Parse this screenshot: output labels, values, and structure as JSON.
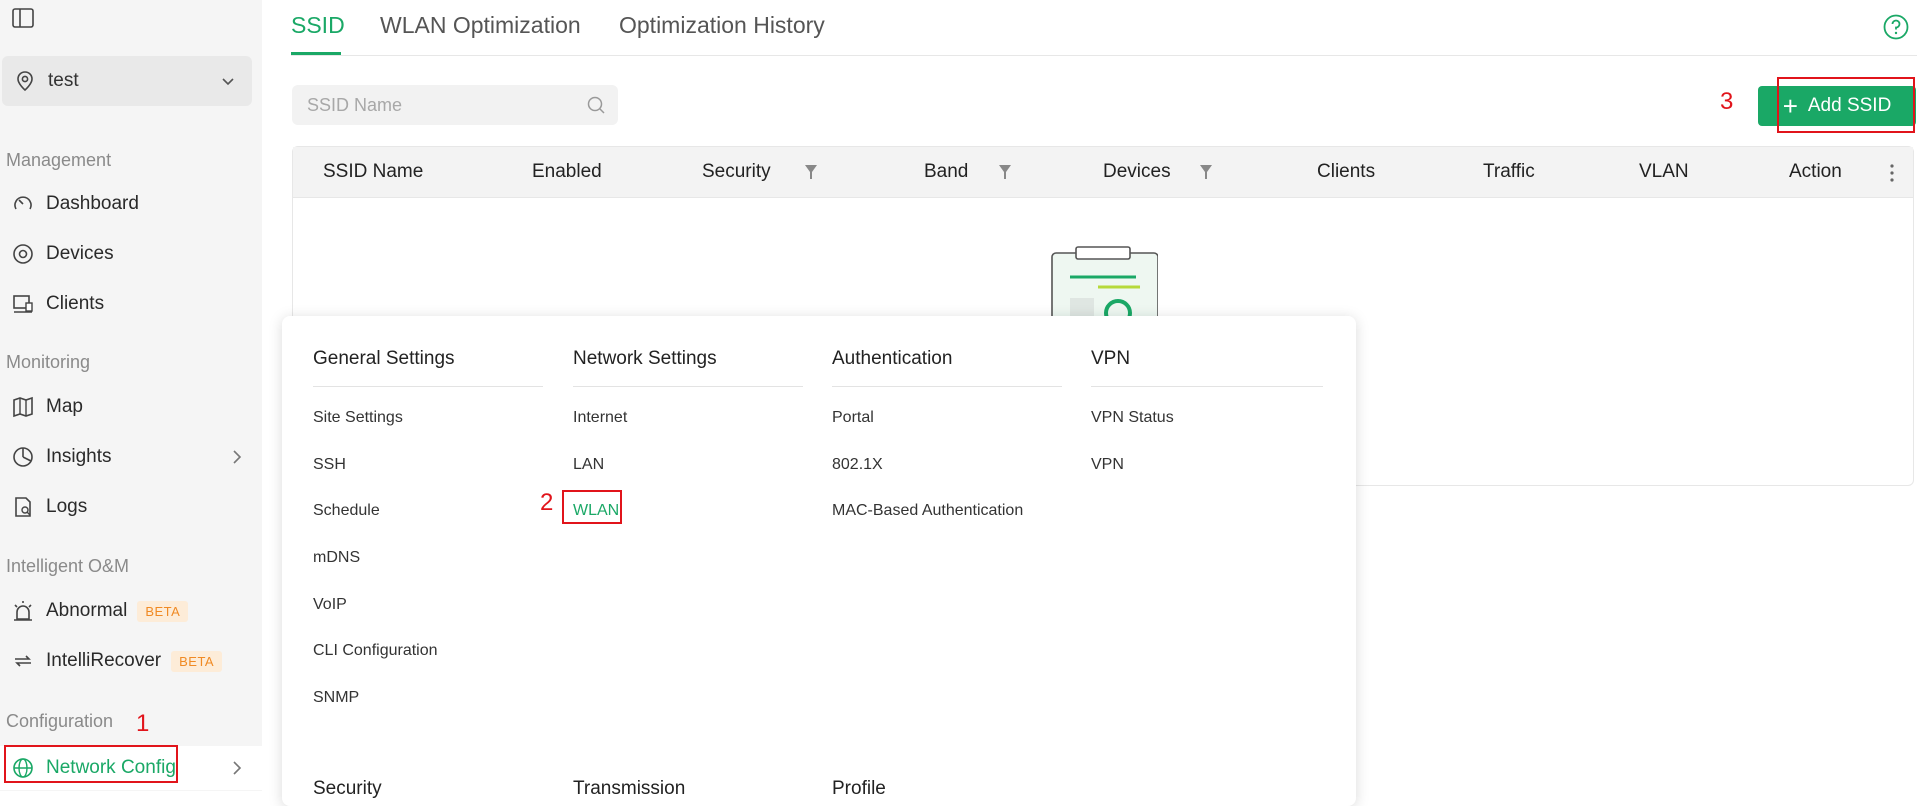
{
  "sidebar": {
    "site": "test",
    "sections": {
      "management": "Management",
      "monitoring": "Monitoring",
      "intelligent": "Intelligent O&M",
      "configuration": "Configuration"
    },
    "items": [
      {
        "label": "Dashboard"
      },
      {
        "label": "Devices"
      },
      {
        "label": "Clients"
      },
      {
        "label": "Map"
      },
      {
        "label": "Insights"
      },
      {
        "label": "Logs"
      },
      {
        "label": "Abnormal",
        "badge": "BETA"
      },
      {
        "label": "IntelliRecover",
        "badge": "BETA"
      },
      {
        "label": "Network Config"
      }
    ]
  },
  "annotations": [
    "1",
    "2",
    "3"
  ],
  "tabs": [
    "SSID",
    "WLAN Optimization",
    "Optimization History"
  ],
  "search": {
    "placeholder": "SSID Name"
  },
  "add_button": "Add SSID",
  "table": {
    "columns": [
      "SSID Name",
      "Enabled",
      "Security",
      "Band",
      "Devices",
      "Clients",
      "Traffic",
      "VLAN",
      "Action"
    ]
  },
  "menu": {
    "columns": [
      {
        "title": "General Settings",
        "items": [
          "Site Settings",
          "SSH",
          "Schedule",
          "mDNS",
          "VoIP",
          "CLI Configuration",
          "SNMP"
        ]
      },
      {
        "title": "Network Settings",
        "items": [
          "Internet",
          "LAN",
          "WLAN"
        ]
      },
      {
        "title": "Authentication",
        "items": [
          "Portal",
          "802.1X",
          "MAC-Based Authentication"
        ]
      },
      {
        "title": "VPN",
        "items": [
          "VPN Status",
          "VPN"
        ]
      }
    ],
    "second_row": [
      "Security",
      "Transmission",
      "Profile"
    ]
  },
  "colors": {
    "accent": "#1aa866",
    "annotation": "#e1141b",
    "badge": "#f08a24"
  }
}
